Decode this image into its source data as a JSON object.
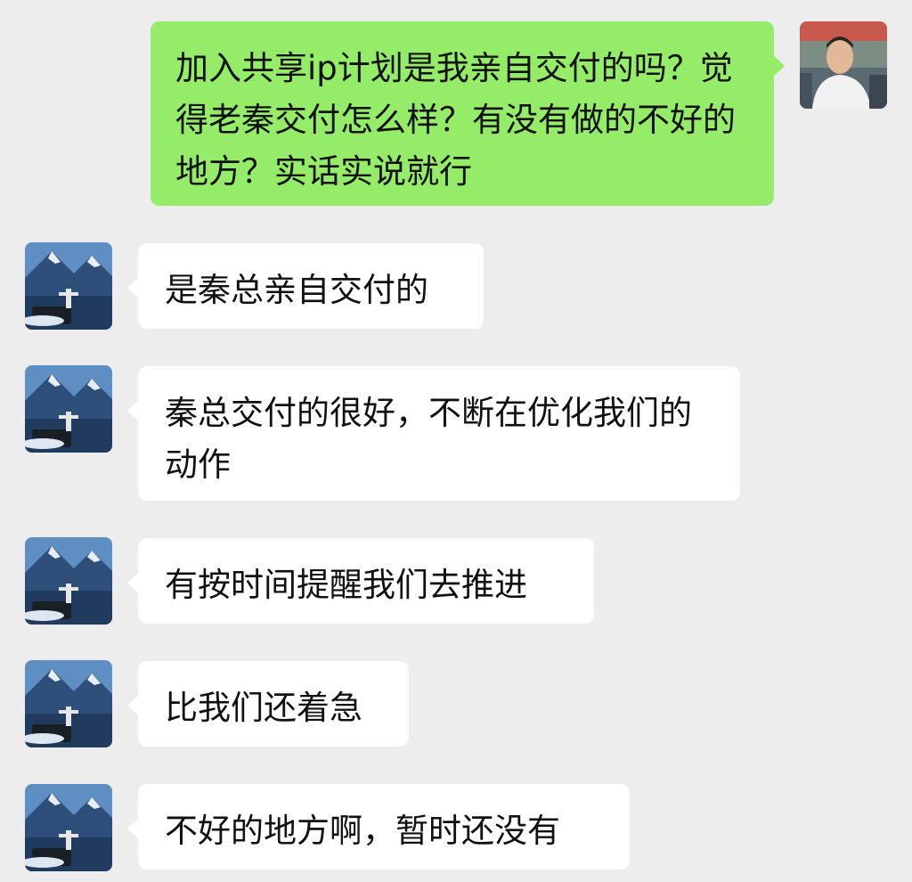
{
  "colors": {
    "background": "#ededed",
    "outgoing_bubble": "#95ec69",
    "incoming_bubble": "#ffffff",
    "text": "#111111"
  },
  "messages": [
    {
      "sender": "me",
      "text": "加入共享ip计划是我亲自交付的吗？觉得老秦交付怎么样？有没有做的不好的地方？实话实说就行"
    },
    {
      "sender": "contact",
      "text": "是秦总亲自交付的"
    },
    {
      "sender": "contact",
      "text": "秦总交付的很好，不断在优化我们的动作"
    },
    {
      "sender": "contact",
      "text": "有按时间提醒我们去推进"
    },
    {
      "sender": "contact",
      "text": "比我们还着急"
    },
    {
      "sender": "contact",
      "text": "不好的地方啊，暂时还没有"
    }
  ],
  "avatars": {
    "me": "person-photo-avatar",
    "contact": "mountain-landscape-avatar"
  }
}
